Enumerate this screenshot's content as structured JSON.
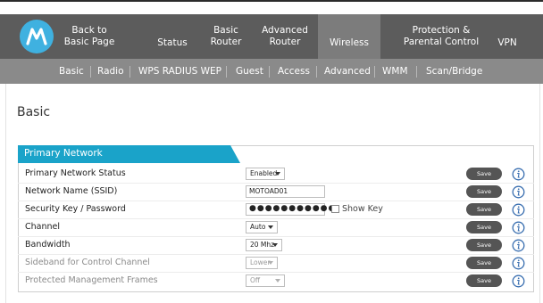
{
  "brand": {
    "logo_icon": "motorola-logo-icon",
    "logo_color": "#3fb1e0"
  },
  "main_nav": {
    "items": [
      {
        "line1": "Back to",
        "line2": "Basic Page"
      },
      {
        "label": "Status"
      },
      {
        "line1": "Basic",
        "line2": "Router"
      },
      {
        "line1": "Advanced",
        "line2": "Router"
      },
      {
        "label": "Wireless"
      },
      {
        "line1": "Protection &",
        "line2": "Parental Control"
      },
      {
        "label": "VPN"
      }
    ],
    "active_label": "Wireless"
  },
  "sub_nav": {
    "items": [
      "Basic",
      "Radio",
      "WPS RADIUS WEP",
      "Guest",
      "Access",
      "Advanced",
      "WMM",
      "Scan/Bridge"
    ],
    "active_label": "Basic"
  },
  "page": {
    "title": "Basic"
  },
  "panel": {
    "header": "Primary Network",
    "header_color": "#1aa3c9",
    "save_label": "Save",
    "show_key_label": "Show Key",
    "rows": [
      {
        "label": "Primary Network Status",
        "control": "select",
        "value": "Enabled"
      },
      {
        "label": "Network Name (SSID)",
        "control": "text",
        "value": "MOTOAD01"
      },
      {
        "label": "Security Key / Password",
        "control": "password",
        "value": "●●●●●●●●●●●"
      },
      {
        "label": "Channel",
        "control": "select",
        "value": "Auto"
      },
      {
        "label": "Bandwidth",
        "control": "select",
        "value": "20 Mhz"
      },
      {
        "label": "Sideband for Control Channel",
        "control": "select",
        "value": "Lower",
        "disabled": true
      },
      {
        "label": "Protected Management Frames",
        "control": "select",
        "value": "Off",
        "disabled": true
      }
    ]
  }
}
